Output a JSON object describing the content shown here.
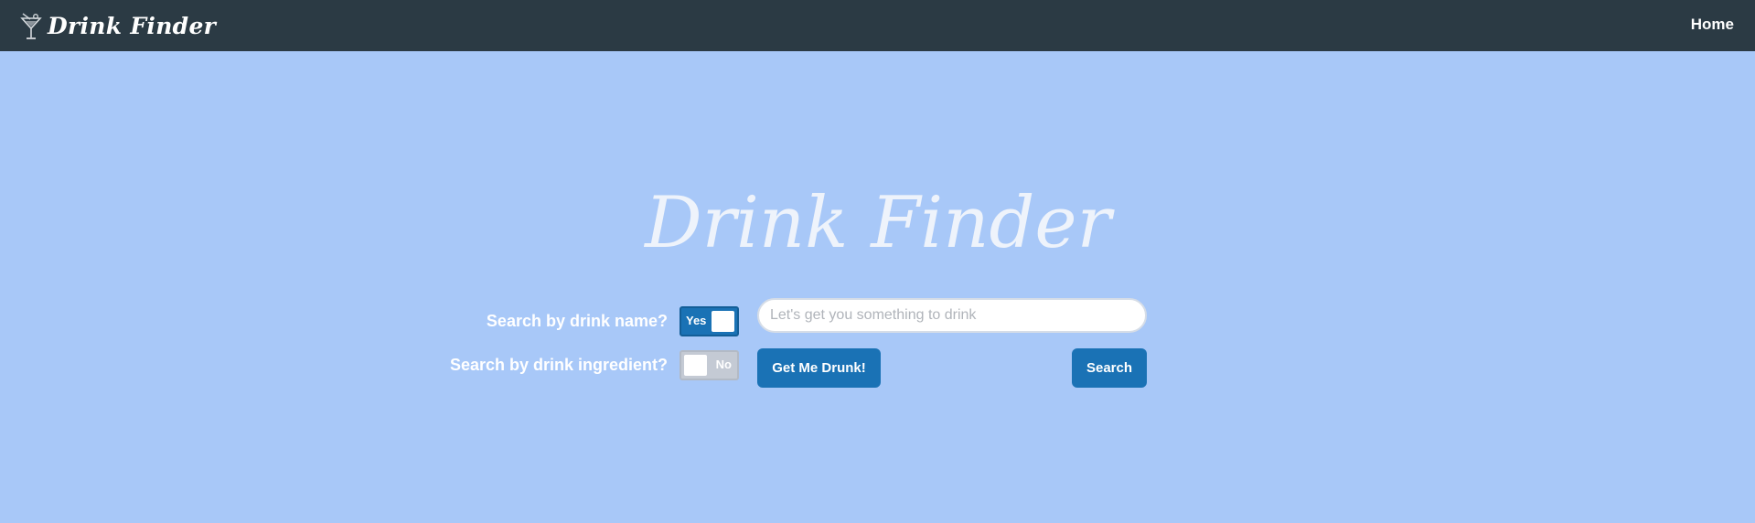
{
  "navbar": {
    "brand": "Drink Finder",
    "brand_icon": "martini-glass-icon",
    "home_link": "Home"
  },
  "hero": {
    "title": "Drink Finder"
  },
  "search_options": {
    "by_name": {
      "label": "Search by drink name?",
      "toggle_text": "Yes",
      "state": true
    },
    "by_ingredient": {
      "label": "Search by drink ingredient?",
      "toggle_text": "No",
      "state": false
    }
  },
  "search": {
    "placeholder": "Let's get you something to drink",
    "value": ""
  },
  "buttons": {
    "random": "Get Me Drunk!",
    "search": "Search"
  },
  "colors": {
    "background": "#a8c8f8",
    "navbar": "#2b3a44",
    "accent": "#1a72b5",
    "toggle_off": "#c4cad4"
  }
}
